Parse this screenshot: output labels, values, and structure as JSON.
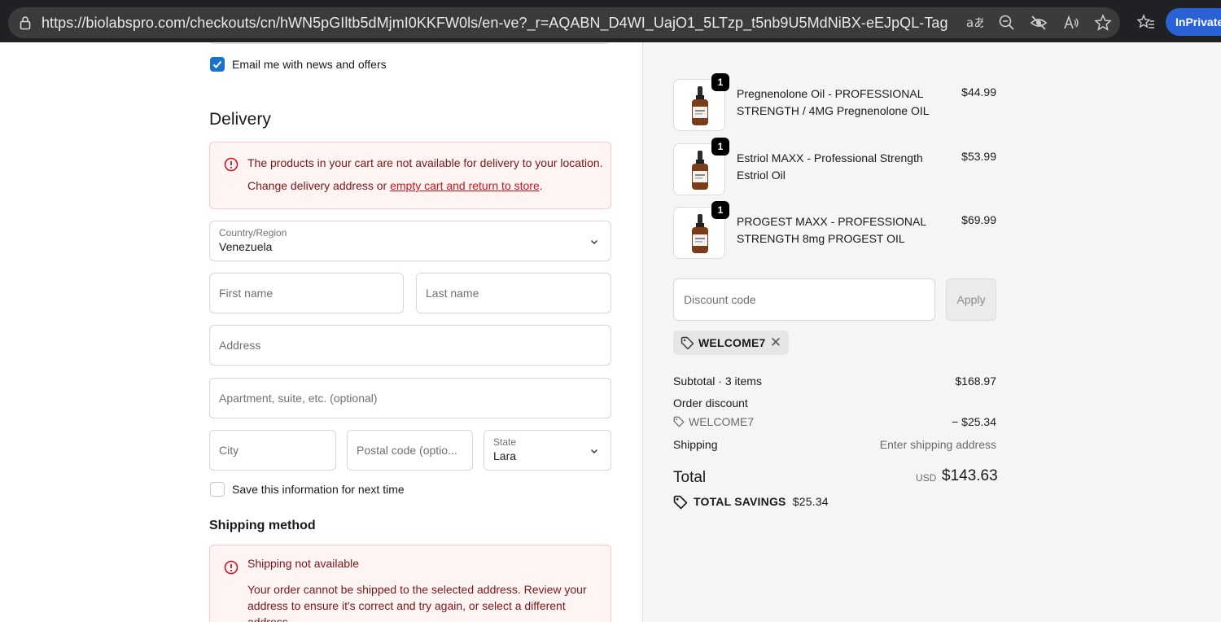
{
  "browser": {
    "url": "https://biolabspro.com/checkouts/cn/hWN5pGIltb5dMjmI0KKFW0ls/en-ve?_r=AQABN_D4WI_UajO1_5LTzp_t5nb9U5MdNiBX-eEJpQL-Tag",
    "inprivate_label": "InPrivate",
    "icons": [
      "lock-icon",
      "read-aloud-icon",
      "zoom-out-icon",
      "tracking-prevention-icon",
      "immersive-reader-icon",
      "favorite-star-icon",
      "favorites-list-icon"
    ]
  },
  "contact": {
    "email_news_label": "Email me with news and offers",
    "email_news_checked": true
  },
  "delivery": {
    "heading": "Delivery",
    "alert": {
      "line1": "The products in your cart are not available for delivery to your location.",
      "line2_prefix": "Change delivery address or ",
      "line2_link": "empty cart and return to store",
      "line2_suffix": "."
    },
    "country": {
      "label": "Country/Region",
      "value": "Venezuela"
    },
    "first_name": {
      "placeholder": "First name"
    },
    "last_name": {
      "placeholder": "Last name"
    },
    "address": {
      "placeholder": "Address"
    },
    "apartment": {
      "placeholder": "Apartment, suite, etc. (optional)"
    },
    "city": {
      "placeholder": "City"
    },
    "postal": {
      "placeholder": "Postal code (optio..."
    },
    "state": {
      "label": "State",
      "value": "Lara"
    },
    "save_info_label": "Save this information for next time",
    "save_info_checked": false
  },
  "shipping_method": {
    "heading": "Shipping method",
    "alert_title": "Shipping not available",
    "alert_line1": "Your order cannot be shipped to the selected address. Review your",
    "alert_line2": "address to ensure it's correct and try again, or select a different",
    "alert_line3": "address."
  },
  "cart": {
    "items": [
      {
        "qty": "1",
        "name_line1": "Pregnenolone Oil - PROFESSIONAL",
        "name_line2": "STRENGTH / 4MG Pregnenolone OIL",
        "price": "$44.99"
      },
      {
        "qty": "1",
        "name_line1": "Estriol MAXX - Professional Strength",
        "name_line2": "Estriol Oil",
        "price": "$53.99"
      },
      {
        "qty": "1",
        "name_line1": "PROGEST MAXX - PROFESSIONAL",
        "name_line2": "STRENGTH 8mg PROGEST OIL",
        "price": "$69.99"
      }
    ],
    "discount_placeholder": "Discount code",
    "apply_label": "Apply",
    "applied_code": "WELCOME7"
  },
  "summary": {
    "subtotal_label": "Subtotal · 3 items",
    "subtotal_value": "$168.97",
    "order_discount_label": "Order discount",
    "discount_code": "WELCOME7",
    "discount_value": "− $25.34",
    "shipping_label": "Shipping",
    "shipping_value": "Enter shipping address",
    "total_label": "Total",
    "currency": "USD",
    "total_value": "$143.63",
    "savings_label": "TOTAL SAVINGS",
    "savings_value": "$25.34"
  },
  "colors": {
    "accent": "#1a73c9",
    "error_text": "#d0121b",
    "error_bg": "#fff4f4",
    "summary_bg": "#f5f5f5",
    "inprivate": "#2a62d6"
  }
}
